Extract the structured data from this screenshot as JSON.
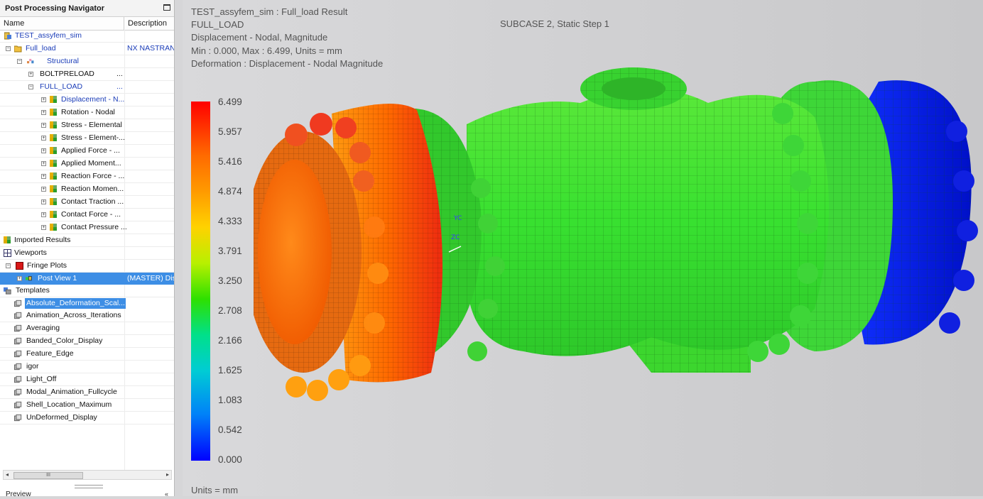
{
  "navigator": {
    "title": "Post Processing Navigator",
    "columns": [
      "Name",
      "Description"
    ],
    "items": [
      {
        "label": "TEST_assyfem_sim",
        "desc": "",
        "level": 0
      },
      {
        "label": "Full_load",
        "desc": "NX NASTRAN,",
        "level": 0
      },
      {
        "label": "Structural",
        "desc": "",
        "level": 1
      },
      {
        "label": "BOLTPRELOAD",
        "desc": "",
        "level": 2,
        "ellipsis": "..."
      },
      {
        "label": "FULL_LOAD",
        "desc": "",
        "level": 2,
        "ellipsis": "..."
      },
      {
        "label": "Displacement - N...",
        "desc": "",
        "level": 3
      },
      {
        "label": "Rotation - Nodal",
        "desc": "",
        "level": 3
      },
      {
        "label": "Stress - Elemental",
        "desc": "",
        "level": 3
      },
      {
        "label": "Stress - Element-...",
        "desc": "",
        "level": 3
      },
      {
        "label": "Applied Force - ...",
        "desc": "",
        "level": 3
      },
      {
        "label": "Applied Moment...",
        "desc": "",
        "level": 3
      },
      {
        "label": "Reaction Force - ...",
        "desc": "",
        "level": 3
      },
      {
        "label": "Reaction Momen...",
        "desc": "",
        "level": 3
      },
      {
        "label": "Contact Traction ...",
        "desc": "",
        "level": 3
      },
      {
        "label": "Contact Force - ...",
        "desc": "",
        "level": 3
      },
      {
        "label": "Contact Pressure ...",
        "desc": "",
        "level": 3
      },
      {
        "label": "Imported Results",
        "desc": "",
        "level": 0
      },
      {
        "label": "Viewports",
        "desc": "",
        "level": 0
      },
      {
        "label": "Fringe Plots",
        "desc": "",
        "level": 0
      },
      {
        "label": "Post View 1",
        "desc": "(MASTER) Disp",
        "level": 1
      },
      {
        "label": "Templates",
        "desc": "",
        "level": 0
      },
      {
        "label": "Absolute_Deformation_Scal...",
        "desc": "",
        "level": 1
      },
      {
        "label": "Animation_Across_Iterations",
        "desc": "",
        "level": 1
      },
      {
        "label": "Averaging",
        "desc": "",
        "level": 1
      },
      {
        "label": "Banded_Color_Display",
        "desc": "",
        "level": 1
      },
      {
        "label": "Feature_Edge",
        "desc": "",
        "level": 1
      },
      {
        "label": "igor",
        "desc": "",
        "level": 1
      },
      {
        "label": "Light_Off",
        "desc": "",
        "level": 1
      },
      {
        "label": "Modal_Animation_Fullcycle",
        "desc": "",
        "level": 1
      },
      {
        "label": "Shell_Location_Maximum",
        "desc": "",
        "level": 1
      },
      {
        "label": "UnDeformed_Display",
        "desc": "",
        "level": 1
      }
    ],
    "scroll_thumb": "III",
    "preview_label": "Preview"
  },
  "viewport": {
    "lines": [
      "TEST_assyfem_sim : Full_load Result",
      "FULL_LOAD",
      "Displacement - Nodal, Magnitude",
      "Min : 0.000, Max : 6.499, Units = mm",
      "Deformation : Displacement - Nodal Magnitude"
    ],
    "subcase": "SUBCASE 2, Static Step 1",
    "legend_ticks": [
      "6.499",
      "5.957",
      "5.416",
      "4.874",
      "4.333",
      "3.791",
      "3.250",
      "2.708",
      "2.166",
      "1.625",
      "1.083",
      "0.542",
      "0.000"
    ],
    "units": "Units = mm",
    "triad": {
      "yc": "YC",
      "zc": "ZC"
    }
  },
  "colors": {
    "selection": "#3d8ee5",
    "link_blue": "#1a3cb8",
    "max": "#ff0000",
    "min": "#0000ff",
    "mid": "#2ee000"
  }
}
